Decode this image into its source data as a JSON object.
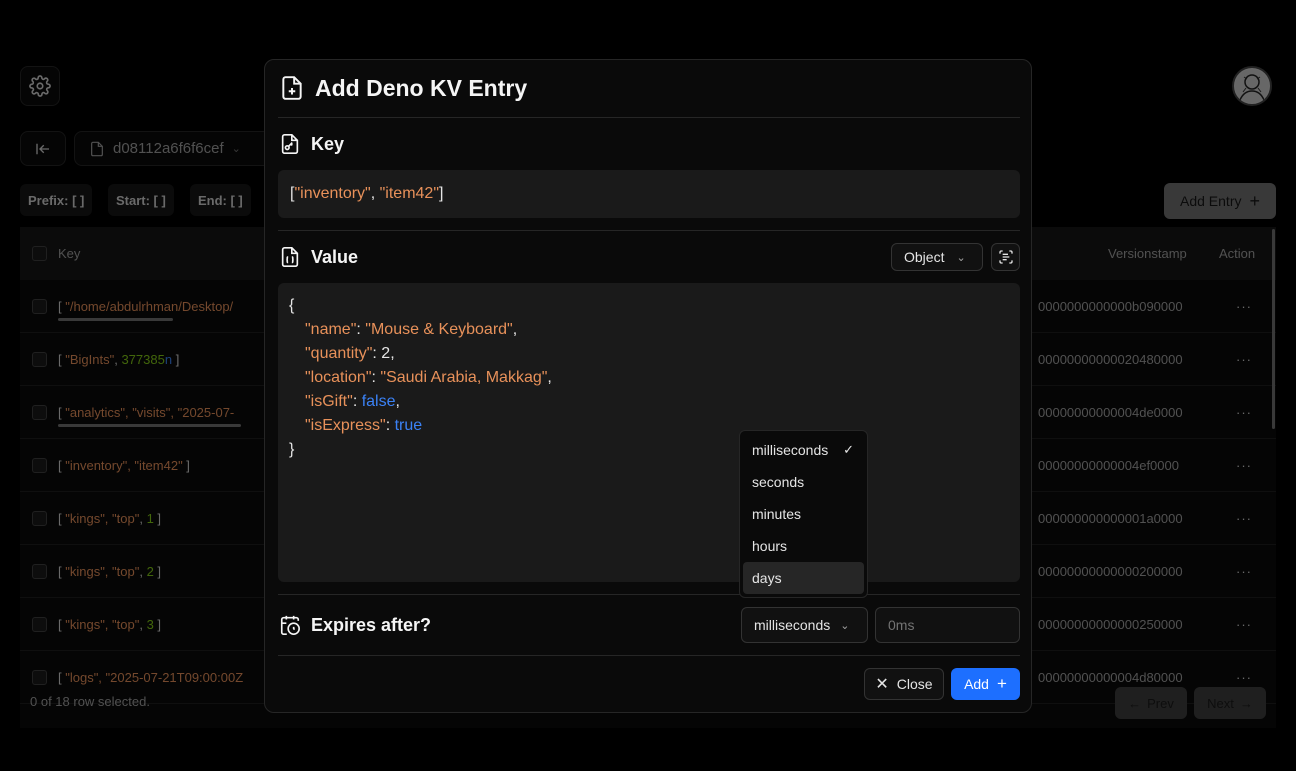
{
  "background": {
    "db_name": "d08112a6f6f6cef",
    "filters": {
      "prefix": "Prefix: [ ]",
      "start": "Start: [ ]",
      "end": "End: [ ]"
    },
    "add_entry_label": "Add Entry",
    "table": {
      "headers": {
        "key": "Key",
        "versionstamp": "Versionstamp",
        "action": "Action"
      },
      "rows": [
        {
          "k1": "[ ",
          "s": "\"/home/abdulrhman/Desktop/",
          "k2": "",
          "versionstamp": "0000000000000b090000"
        },
        {
          "k1": "[ ",
          "s": "\"BigInts\"",
          "sep": ", ",
          "n": "377385",
          "nl": "n",
          "end": " ]",
          "versionstamp": "00000000000020480000"
        },
        {
          "k1": "[ ",
          "s": "\"analytics\", \"visits\", \"2025-07-",
          "versionstamp": "00000000000004de0000"
        },
        {
          "k1": "[ ",
          "s": "\"inventory\", \"item42\"",
          "end": " ]",
          "versionstamp": "00000000000004ef0000"
        },
        {
          "k1": "[ ",
          "s": "\"kings\", \"top\"",
          "sep": ", ",
          "n": "1",
          "end": " ]",
          "versionstamp": "000000000000001a0000"
        },
        {
          "k1": "[ ",
          "s": "\"kings\", \"top\"",
          "sep": ", ",
          "n": "2",
          "end": " ]",
          "versionstamp": "00000000000000200000"
        },
        {
          "k1": "[ ",
          "s": "\"kings\", \"top\"",
          "sep": ", ",
          "n": "3",
          "end": " ]",
          "versionstamp": "00000000000000250000"
        },
        {
          "k1": "[ ",
          "s": "\"logs\", \"2025-07-21T09:00:00Z",
          "versionstamp": "00000000000004d80000"
        }
      ]
    },
    "footer": {
      "selection": "0 of 18 row selected.",
      "prev": "Prev",
      "next": "Next"
    }
  },
  "modal": {
    "title": "Add Deno KV Entry",
    "key_label": "Key",
    "key_value": {
      "open": "[",
      "part1": "\"inventory\"",
      "sep": ", ",
      "part2": "\"item42\"",
      "close": "]"
    },
    "value_label": "Value",
    "value_type": "Object",
    "value_json": [
      {
        "k": "\"name\"",
        "v": "\"Mouse & Keyboard\"",
        "vt": "str",
        "comma": ","
      },
      {
        "k": "\"quantity\"",
        "v": "2",
        "vt": "num",
        "comma": ","
      },
      {
        "k": "\"location\"",
        "v": "\"Saudi Arabia, Makkag\"",
        "vt": "str",
        "comma": ","
      },
      {
        "k": "\"isGift\"",
        "v": "false",
        "vt": "bool",
        "comma": ","
      },
      {
        "k": "\"isExpress\"",
        "v": "true",
        "vt": "bool",
        "comma": ""
      }
    ],
    "expires_label": "Expires after?",
    "expires_unit": "milliseconds",
    "expires_placeholder": "0ms",
    "close_label": "Close",
    "add_label": "Add",
    "unit_options": [
      {
        "label": "milliseconds",
        "selected": true
      },
      {
        "label": "seconds",
        "selected": false
      },
      {
        "label": "minutes",
        "selected": false
      },
      {
        "label": "hours",
        "selected": false
      },
      {
        "label": "days",
        "selected": false
      }
    ]
  },
  "colors": {
    "accent": "#1d6fff",
    "string": "#e8915a",
    "boolean": "#3b82f6",
    "number": "#84cc16"
  }
}
